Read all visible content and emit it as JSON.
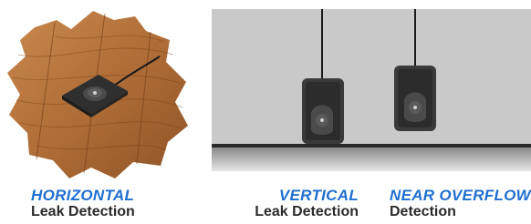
{
  "captions": [
    {
      "mode": "HORIZONTAL",
      "description": "Leak Detection"
    },
    {
      "mode": "VERTICAL",
      "description": "Leak Detection"
    },
    {
      "mode": "NEAR OVERFLOW",
      "description": "Detection"
    }
  ],
  "colors": {
    "mode_label": "#1f6fd1",
    "description_label": "#2b2b2b",
    "wood": "#b8763f",
    "wall": "#c9c9c9",
    "sensor": "#3a3a3a"
  },
  "icons": [
    "wood-floor-sensor-illustration",
    "wall-mounted-sensor-illustration"
  ]
}
